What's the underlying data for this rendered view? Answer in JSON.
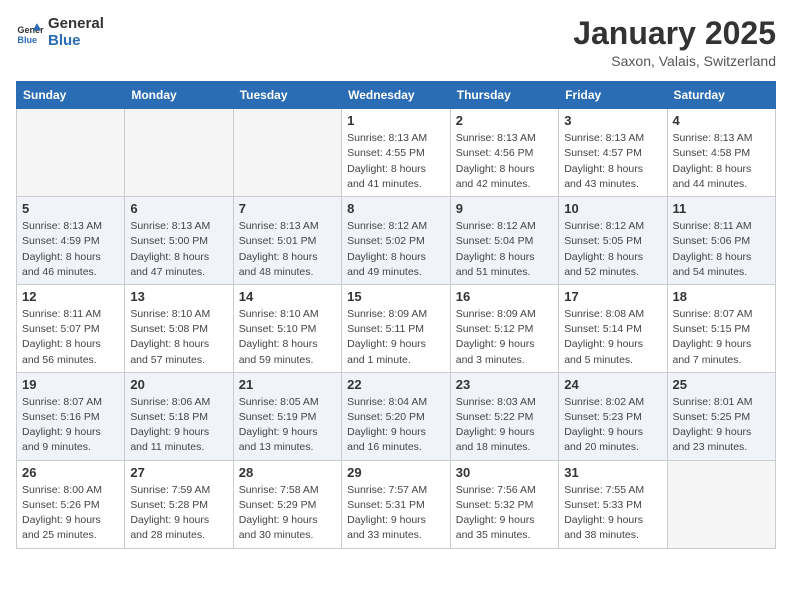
{
  "header": {
    "logo_general": "General",
    "logo_blue": "Blue",
    "month_title": "January 2025",
    "location": "Saxon, Valais, Switzerland"
  },
  "weekdays": [
    "Sunday",
    "Monday",
    "Tuesday",
    "Wednesday",
    "Thursday",
    "Friday",
    "Saturday"
  ],
  "weeks": [
    [
      {
        "day": "",
        "info": ""
      },
      {
        "day": "",
        "info": ""
      },
      {
        "day": "",
        "info": ""
      },
      {
        "day": "1",
        "info": "Sunrise: 8:13 AM\nSunset: 4:55 PM\nDaylight: 8 hours and 41 minutes."
      },
      {
        "day": "2",
        "info": "Sunrise: 8:13 AM\nSunset: 4:56 PM\nDaylight: 8 hours and 42 minutes."
      },
      {
        "day": "3",
        "info": "Sunrise: 8:13 AM\nSunset: 4:57 PM\nDaylight: 8 hours and 43 minutes."
      },
      {
        "day": "4",
        "info": "Sunrise: 8:13 AM\nSunset: 4:58 PM\nDaylight: 8 hours and 44 minutes."
      }
    ],
    [
      {
        "day": "5",
        "info": "Sunrise: 8:13 AM\nSunset: 4:59 PM\nDaylight: 8 hours and 46 minutes."
      },
      {
        "day": "6",
        "info": "Sunrise: 8:13 AM\nSunset: 5:00 PM\nDaylight: 8 hours and 47 minutes."
      },
      {
        "day": "7",
        "info": "Sunrise: 8:13 AM\nSunset: 5:01 PM\nDaylight: 8 hours and 48 minutes."
      },
      {
        "day": "8",
        "info": "Sunrise: 8:12 AM\nSunset: 5:02 PM\nDaylight: 8 hours and 49 minutes."
      },
      {
        "day": "9",
        "info": "Sunrise: 8:12 AM\nSunset: 5:04 PM\nDaylight: 8 hours and 51 minutes."
      },
      {
        "day": "10",
        "info": "Sunrise: 8:12 AM\nSunset: 5:05 PM\nDaylight: 8 hours and 52 minutes."
      },
      {
        "day": "11",
        "info": "Sunrise: 8:11 AM\nSunset: 5:06 PM\nDaylight: 8 hours and 54 minutes."
      }
    ],
    [
      {
        "day": "12",
        "info": "Sunrise: 8:11 AM\nSunset: 5:07 PM\nDaylight: 8 hours and 56 minutes."
      },
      {
        "day": "13",
        "info": "Sunrise: 8:10 AM\nSunset: 5:08 PM\nDaylight: 8 hours and 57 minutes."
      },
      {
        "day": "14",
        "info": "Sunrise: 8:10 AM\nSunset: 5:10 PM\nDaylight: 8 hours and 59 minutes."
      },
      {
        "day": "15",
        "info": "Sunrise: 8:09 AM\nSunset: 5:11 PM\nDaylight: 9 hours and 1 minute."
      },
      {
        "day": "16",
        "info": "Sunrise: 8:09 AM\nSunset: 5:12 PM\nDaylight: 9 hours and 3 minutes."
      },
      {
        "day": "17",
        "info": "Sunrise: 8:08 AM\nSunset: 5:14 PM\nDaylight: 9 hours and 5 minutes."
      },
      {
        "day": "18",
        "info": "Sunrise: 8:07 AM\nSunset: 5:15 PM\nDaylight: 9 hours and 7 minutes."
      }
    ],
    [
      {
        "day": "19",
        "info": "Sunrise: 8:07 AM\nSunset: 5:16 PM\nDaylight: 9 hours and 9 minutes."
      },
      {
        "day": "20",
        "info": "Sunrise: 8:06 AM\nSunset: 5:18 PM\nDaylight: 9 hours and 11 minutes."
      },
      {
        "day": "21",
        "info": "Sunrise: 8:05 AM\nSunset: 5:19 PM\nDaylight: 9 hours and 13 minutes."
      },
      {
        "day": "22",
        "info": "Sunrise: 8:04 AM\nSunset: 5:20 PM\nDaylight: 9 hours and 16 minutes."
      },
      {
        "day": "23",
        "info": "Sunrise: 8:03 AM\nSunset: 5:22 PM\nDaylight: 9 hours and 18 minutes."
      },
      {
        "day": "24",
        "info": "Sunrise: 8:02 AM\nSunset: 5:23 PM\nDaylight: 9 hours and 20 minutes."
      },
      {
        "day": "25",
        "info": "Sunrise: 8:01 AM\nSunset: 5:25 PM\nDaylight: 9 hours and 23 minutes."
      }
    ],
    [
      {
        "day": "26",
        "info": "Sunrise: 8:00 AM\nSunset: 5:26 PM\nDaylight: 9 hours and 25 minutes."
      },
      {
        "day": "27",
        "info": "Sunrise: 7:59 AM\nSunset: 5:28 PM\nDaylight: 9 hours and 28 minutes."
      },
      {
        "day": "28",
        "info": "Sunrise: 7:58 AM\nSunset: 5:29 PM\nDaylight: 9 hours and 30 minutes."
      },
      {
        "day": "29",
        "info": "Sunrise: 7:57 AM\nSunset: 5:31 PM\nDaylight: 9 hours and 33 minutes."
      },
      {
        "day": "30",
        "info": "Sunrise: 7:56 AM\nSunset: 5:32 PM\nDaylight: 9 hours and 35 minutes."
      },
      {
        "day": "31",
        "info": "Sunrise: 7:55 AM\nSunset: 5:33 PM\nDaylight: 9 hours and 38 minutes."
      },
      {
        "day": "",
        "info": ""
      }
    ]
  ]
}
